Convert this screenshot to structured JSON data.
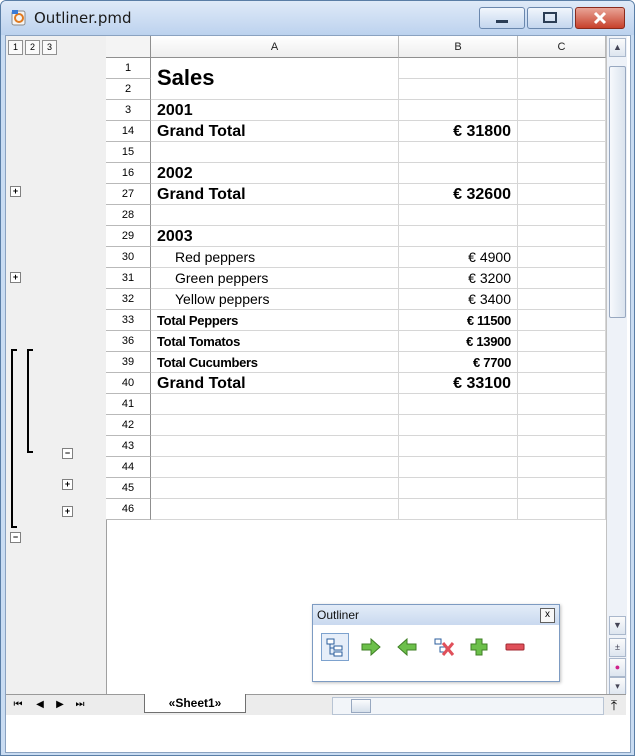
{
  "window": {
    "title": "Outliner.pmd"
  },
  "outline_levels": [
    "1",
    "2",
    "3"
  ],
  "columns": [
    "A",
    "B",
    "C"
  ],
  "rows": [
    {
      "num": "1",
      "a": "Sales",
      "b": "",
      "style": "big"
    },
    {
      "num": "2",
      "a": "",
      "b": "",
      "style": ""
    },
    {
      "num": "3",
      "a": "2001",
      "b": "",
      "style": "hdr2"
    },
    {
      "num": "14",
      "a": "Grand Total",
      "b": "€ 31800",
      "style": "gt"
    },
    {
      "num": "15",
      "a": "",
      "b": "",
      "style": ""
    },
    {
      "num": "16",
      "a": "2002",
      "b": "",
      "style": "hdr2"
    },
    {
      "num": "27",
      "a": "Grand Total",
      "b": "€ 32600",
      "style": "gt"
    },
    {
      "num": "28",
      "a": "",
      "b": "",
      "style": ""
    },
    {
      "num": "29",
      "a": "2003",
      "b": "",
      "style": "hdr2"
    },
    {
      "num": "30",
      "a": "Red peppers",
      "b": "€ 4900",
      "style": "item"
    },
    {
      "num": "31",
      "a": "Green peppers",
      "b": "€ 3200",
      "style": "item"
    },
    {
      "num": "32",
      "a": "Yellow peppers",
      "b": "€ 3400",
      "style": "item"
    },
    {
      "num": "33",
      "a": "Total Peppers",
      "b": "€ 11500",
      "style": "sub"
    },
    {
      "num": "36",
      "a": "Total Tomatos",
      "b": "€ 13900",
      "style": "sub"
    },
    {
      "num": "39",
      "a": "Total Cucumbers",
      "b": "€ 7700",
      "style": "sub"
    },
    {
      "num": "40",
      "a": "Grand Total",
      "b": "€ 33100",
      "style": "gt"
    },
    {
      "num": "41",
      "a": "",
      "b": "",
      "style": ""
    },
    {
      "num": "42",
      "a": "",
      "b": "",
      "style": ""
    },
    {
      "num": "43",
      "a": "",
      "b": "",
      "style": ""
    },
    {
      "num": "44",
      "a": "",
      "b": "",
      "style": ""
    },
    {
      "num": "45",
      "a": "",
      "b": "",
      "style": ""
    },
    {
      "num": "46",
      "a": "",
      "b": "",
      "style": ""
    }
  ],
  "sheet_tab": "«Sheet1»",
  "outliner_toolbar": {
    "title": "Outliner",
    "close_label": "x"
  },
  "colors": {
    "accent": "#5a7ea6",
    "close_button": "#c7412c",
    "green_arrow": "#6cc04a",
    "red_minus": "#e0505a"
  }
}
